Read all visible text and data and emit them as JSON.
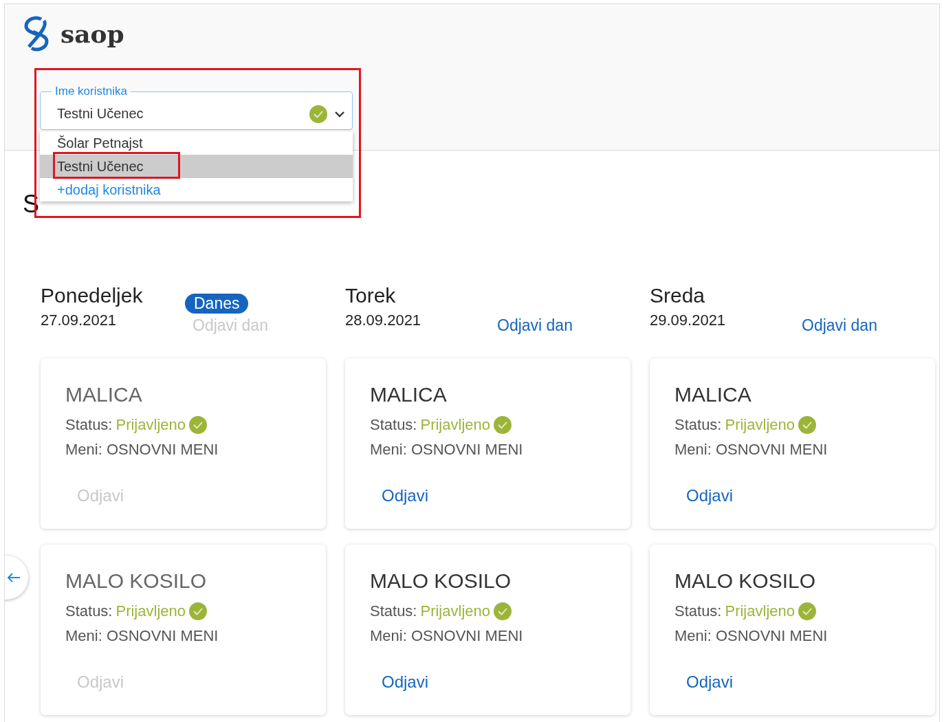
{
  "logo": {
    "text": "saop"
  },
  "user_select": {
    "label": "Ime koristnika",
    "value": "Testni Učenec",
    "valid": true,
    "expanded": true,
    "options": [
      {
        "label": "Šolar Petnajst",
        "selected": false
      },
      {
        "label": "Testni Učenec",
        "selected": true
      }
    ],
    "add_link": "+dodaj koristnika"
  },
  "heading": "S",
  "days": [
    {
      "name": "Ponedeljek",
      "date": "27.09.2021",
      "today": true,
      "today_label": "Danes",
      "cancel_day": {
        "label": "Odjavi dan",
        "disabled": true
      },
      "meals": [
        {
          "title": "MALICA",
          "status_label": "Status:",
          "status": "Prijavljeno",
          "registered": true,
          "menu": "Meni: OSNOVNI MENI",
          "cancel": {
            "label": "Odjavi",
            "disabled": true
          }
        },
        {
          "title": "MALO KOSILO",
          "status_label": "Status:",
          "status": "Prijavljeno",
          "registered": true,
          "menu": "Meni: OSNOVNI MENI",
          "cancel": {
            "label": "Odjavi",
            "disabled": true
          }
        }
      ]
    },
    {
      "name": "Torek",
      "date": "28.09.2021",
      "today": false,
      "cancel_day": {
        "label": "Odjavi dan",
        "disabled": false
      },
      "meals": [
        {
          "title": "MALICA",
          "status_label": "Status:",
          "status": "Prijavljeno",
          "registered": true,
          "menu": "Meni: OSNOVNI MENI",
          "cancel": {
            "label": "Odjavi",
            "disabled": false
          }
        },
        {
          "title": "MALO KOSILO",
          "status_label": "Status:",
          "status": "Prijavljeno",
          "registered": true,
          "menu": "Meni: OSNOVNI MENI",
          "cancel": {
            "label": "Odjavi",
            "disabled": false
          }
        }
      ]
    },
    {
      "name": "Sreda",
      "date": "29.09.2021",
      "today": false,
      "cancel_day": {
        "label": "Odjavi dan",
        "disabled": false
      },
      "meals": [
        {
          "title": "MALICA",
          "status_label": "Status:",
          "status": "Prijavljeno",
          "registered": true,
          "menu": "Meni: OSNOVNI MENI",
          "cancel": {
            "label": "Odjavi",
            "disabled": false
          }
        },
        {
          "title": "MALO KOSILO",
          "status_label": "Status:",
          "status": "Prijavljeno",
          "registered": true,
          "menu": "Meni: OSNOVNI MENI",
          "cancel": {
            "label": "Odjavi",
            "disabled": false
          }
        }
      ]
    }
  ]
}
